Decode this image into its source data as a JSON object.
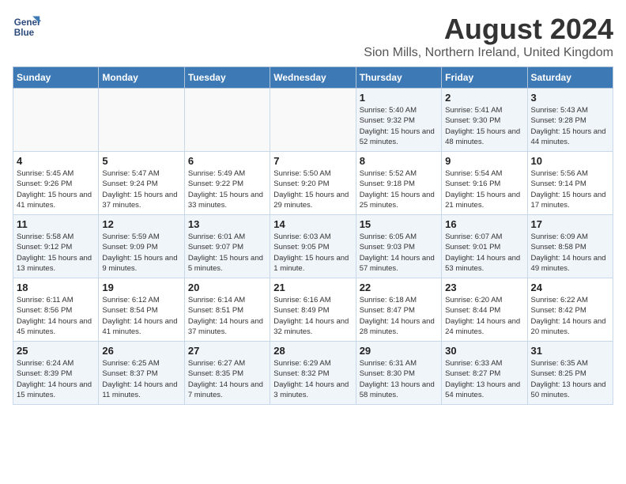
{
  "logo": {
    "line1": "General",
    "line2": "Blue"
  },
  "title": "August 2024",
  "subtitle": "Sion Mills, Northern Ireland, United Kingdom",
  "days_of_week": [
    "Sunday",
    "Monday",
    "Tuesday",
    "Wednesday",
    "Thursday",
    "Friday",
    "Saturday"
  ],
  "weeks": [
    [
      {
        "day": "",
        "info": ""
      },
      {
        "day": "",
        "info": ""
      },
      {
        "day": "",
        "info": ""
      },
      {
        "day": "",
        "info": ""
      },
      {
        "day": "1",
        "info": "Sunrise: 5:40 AM\nSunset: 9:32 PM\nDaylight: 15 hours and 52 minutes."
      },
      {
        "day": "2",
        "info": "Sunrise: 5:41 AM\nSunset: 9:30 PM\nDaylight: 15 hours and 48 minutes."
      },
      {
        "day": "3",
        "info": "Sunrise: 5:43 AM\nSunset: 9:28 PM\nDaylight: 15 hours and 44 minutes."
      }
    ],
    [
      {
        "day": "4",
        "info": "Sunrise: 5:45 AM\nSunset: 9:26 PM\nDaylight: 15 hours and 41 minutes."
      },
      {
        "day": "5",
        "info": "Sunrise: 5:47 AM\nSunset: 9:24 PM\nDaylight: 15 hours and 37 minutes."
      },
      {
        "day": "6",
        "info": "Sunrise: 5:49 AM\nSunset: 9:22 PM\nDaylight: 15 hours and 33 minutes."
      },
      {
        "day": "7",
        "info": "Sunrise: 5:50 AM\nSunset: 9:20 PM\nDaylight: 15 hours and 29 minutes."
      },
      {
        "day": "8",
        "info": "Sunrise: 5:52 AM\nSunset: 9:18 PM\nDaylight: 15 hours and 25 minutes."
      },
      {
        "day": "9",
        "info": "Sunrise: 5:54 AM\nSunset: 9:16 PM\nDaylight: 15 hours and 21 minutes."
      },
      {
        "day": "10",
        "info": "Sunrise: 5:56 AM\nSunset: 9:14 PM\nDaylight: 15 hours and 17 minutes."
      }
    ],
    [
      {
        "day": "11",
        "info": "Sunrise: 5:58 AM\nSunset: 9:12 PM\nDaylight: 15 hours and 13 minutes."
      },
      {
        "day": "12",
        "info": "Sunrise: 5:59 AM\nSunset: 9:09 PM\nDaylight: 15 hours and 9 minutes."
      },
      {
        "day": "13",
        "info": "Sunrise: 6:01 AM\nSunset: 9:07 PM\nDaylight: 15 hours and 5 minutes."
      },
      {
        "day": "14",
        "info": "Sunrise: 6:03 AM\nSunset: 9:05 PM\nDaylight: 15 hours and 1 minute."
      },
      {
        "day": "15",
        "info": "Sunrise: 6:05 AM\nSunset: 9:03 PM\nDaylight: 14 hours and 57 minutes."
      },
      {
        "day": "16",
        "info": "Sunrise: 6:07 AM\nSunset: 9:01 PM\nDaylight: 14 hours and 53 minutes."
      },
      {
        "day": "17",
        "info": "Sunrise: 6:09 AM\nSunset: 8:58 PM\nDaylight: 14 hours and 49 minutes."
      }
    ],
    [
      {
        "day": "18",
        "info": "Sunrise: 6:11 AM\nSunset: 8:56 PM\nDaylight: 14 hours and 45 minutes."
      },
      {
        "day": "19",
        "info": "Sunrise: 6:12 AM\nSunset: 8:54 PM\nDaylight: 14 hours and 41 minutes."
      },
      {
        "day": "20",
        "info": "Sunrise: 6:14 AM\nSunset: 8:51 PM\nDaylight: 14 hours and 37 minutes."
      },
      {
        "day": "21",
        "info": "Sunrise: 6:16 AM\nSunset: 8:49 PM\nDaylight: 14 hours and 32 minutes."
      },
      {
        "day": "22",
        "info": "Sunrise: 6:18 AM\nSunset: 8:47 PM\nDaylight: 14 hours and 28 minutes."
      },
      {
        "day": "23",
        "info": "Sunrise: 6:20 AM\nSunset: 8:44 PM\nDaylight: 14 hours and 24 minutes."
      },
      {
        "day": "24",
        "info": "Sunrise: 6:22 AM\nSunset: 8:42 PM\nDaylight: 14 hours and 20 minutes."
      }
    ],
    [
      {
        "day": "25",
        "info": "Sunrise: 6:24 AM\nSunset: 8:39 PM\nDaylight: 14 hours and 15 minutes."
      },
      {
        "day": "26",
        "info": "Sunrise: 6:25 AM\nSunset: 8:37 PM\nDaylight: 14 hours and 11 minutes."
      },
      {
        "day": "27",
        "info": "Sunrise: 6:27 AM\nSunset: 8:35 PM\nDaylight: 14 hours and 7 minutes."
      },
      {
        "day": "28",
        "info": "Sunrise: 6:29 AM\nSunset: 8:32 PM\nDaylight: 14 hours and 3 minutes."
      },
      {
        "day": "29",
        "info": "Sunrise: 6:31 AM\nSunset: 8:30 PM\nDaylight: 13 hours and 58 minutes."
      },
      {
        "day": "30",
        "info": "Sunrise: 6:33 AM\nSunset: 8:27 PM\nDaylight: 13 hours and 54 minutes."
      },
      {
        "day": "31",
        "info": "Sunrise: 6:35 AM\nSunset: 8:25 PM\nDaylight: 13 hours and 50 minutes."
      }
    ]
  ]
}
